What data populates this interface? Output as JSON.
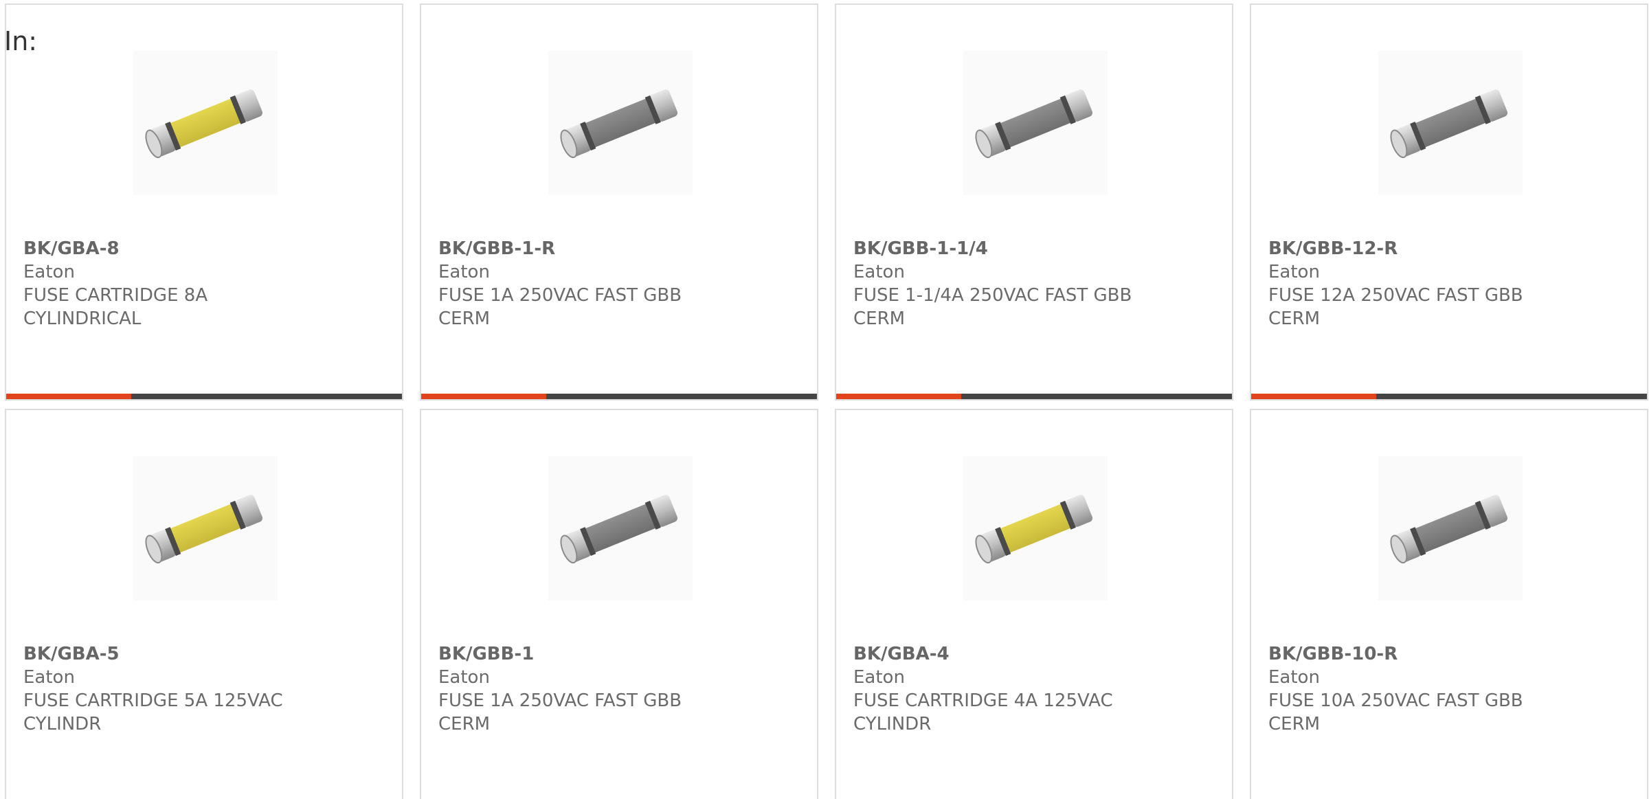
{
  "page": {
    "label": "In:"
  },
  "colors": {
    "accent_orange": "#e1431b",
    "accent_dark": "#454545",
    "card_border": "#dddddd",
    "text": "#6a6a6a",
    "fuse_yellow": "#e4d64e",
    "fuse_gray": "#8f8f8f"
  },
  "products": [
    {
      "part_number": "BK/GBA-8",
      "manufacturer": "Eaton",
      "description": "FUSE CARTRIDGE 8A CYLINDRICAL",
      "fuse_color": "yellow"
    },
    {
      "part_number": "BK/GBB-1-R",
      "manufacturer": "Eaton",
      "description": "FUSE 1A 250VAC FAST GBB CERM",
      "fuse_color": "gray"
    },
    {
      "part_number": "BK/GBB-1-1/4",
      "manufacturer": "Eaton",
      "description": "FUSE 1-1/4A 250VAC FAST GBB CERM",
      "fuse_color": "gray"
    },
    {
      "part_number": "BK/GBB-12-R",
      "manufacturer": "Eaton",
      "description": "FUSE 12A 250VAC FAST GBB CERM",
      "fuse_color": "gray"
    },
    {
      "part_number": "BK/GBA-5",
      "manufacturer": "Eaton",
      "description": "FUSE CARTRIDGE 5A 125VAC CYLINDR",
      "fuse_color": "yellow"
    },
    {
      "part_number": "BK/GBB-1",
      "manufacturer": "Eaton",
      "description": "FUSE 1A 250VAC FAST GBB CERM",
      "fuse_color": "gray"
    },
    {
      "part_number": "BK/GBA-4",
      "manufacturer": "Eaton",
      "description": "FUSE CARTRIDGE 4A 125VAC CYLINDR",
      "fuse_color": "yellow"
    },
    {
      "part_number": "BK/GBB-10-R",
      "manufacturer": "Eaton",
      "description": "FUSE 10A 250VAC FAST GBB CERM",
      "fuse_color": "gray"
    }
  ]
}
